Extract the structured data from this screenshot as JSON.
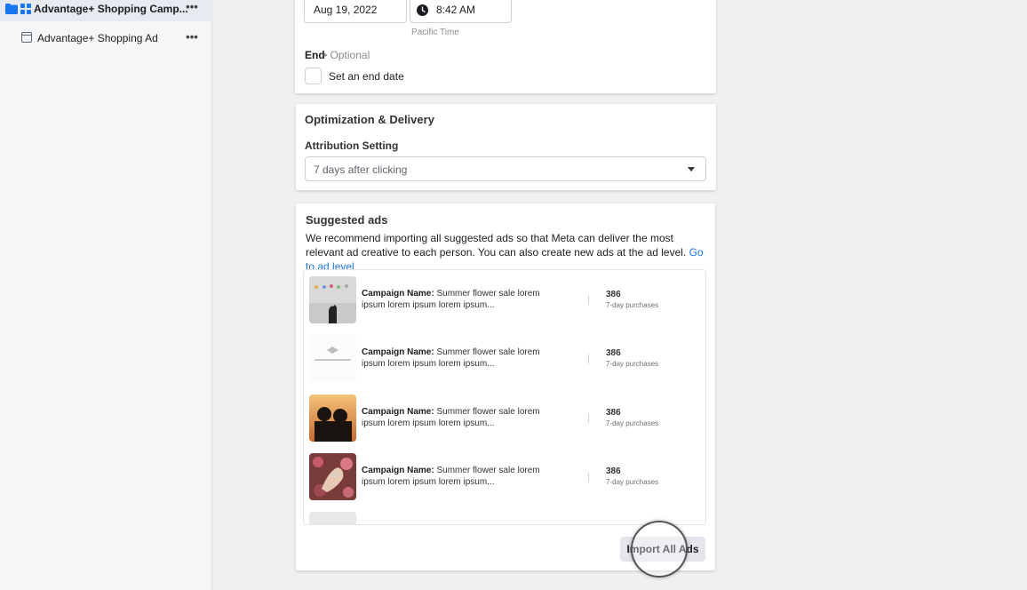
{
  "sidebar": {
    "campaign": {
      "label": "Advantage+ Shopping Camp...",
      "more": "•••"
    },
    "ad": {
      "label": "Advantage+ Shopping Ad",
      "more": "•••"
    }
  },
  "schedule": {
    "start_date": "Aug 19, 2022",
    "start_time": "8:42 AM",
    "timezone": "Pacific Time",
    "end_label": "End",
    "end_optional": "• Optional",
    "end_checkbox_label": "Set an end date"
  },
  "optimization": {
    "title": "Optimization & Delivery",
    "attribution_label": "Attribution Setting",
    "attribution_value": "7 days after clicking"
  },
  "suggested": {
    "title": "Suggested ads",
    "description": "We recommend importing all suggested ads so that Meta can deliver the most relevant ad creative to each person. You can also create new ads at the ad level.",
    "link": "Go to ad level",
    "ads": [
      {
        "name_label": "Campaign Name:",
        "name": "Summer flower sale lorem ipsum lorem ipsum lorem ipsum...",
        "value": "386",
        "metric": "7-day purchases"
      },
      {
        "name_label": "Campaign Name:",
        "name": "Summer flower sale lorem ipsum lorem ipsum lorem ipsum...",
        "value": "386",
        "metric": "7-day purchases"
      },
      {
        "name_label": "Campaign Name:",
        "name": "Summer flower sale lorem ipsum lorem ipsum lorem ipsum...",
        "value": "386",
        "metric": "7-day purchases"
      },
      {
        "name_label": "Campaign Name:",
        "name": "Summer flower sale lorem ipsum lorem ipsum lorem ipsum...",
        "value": "386",
        "metric": "7-day purchases"
      }
    ],
    "import_button": "Import All Ads"
  },
  "colors": {
    "link": "#1877f2",
    "folder": "#1877f2"
  }
}
